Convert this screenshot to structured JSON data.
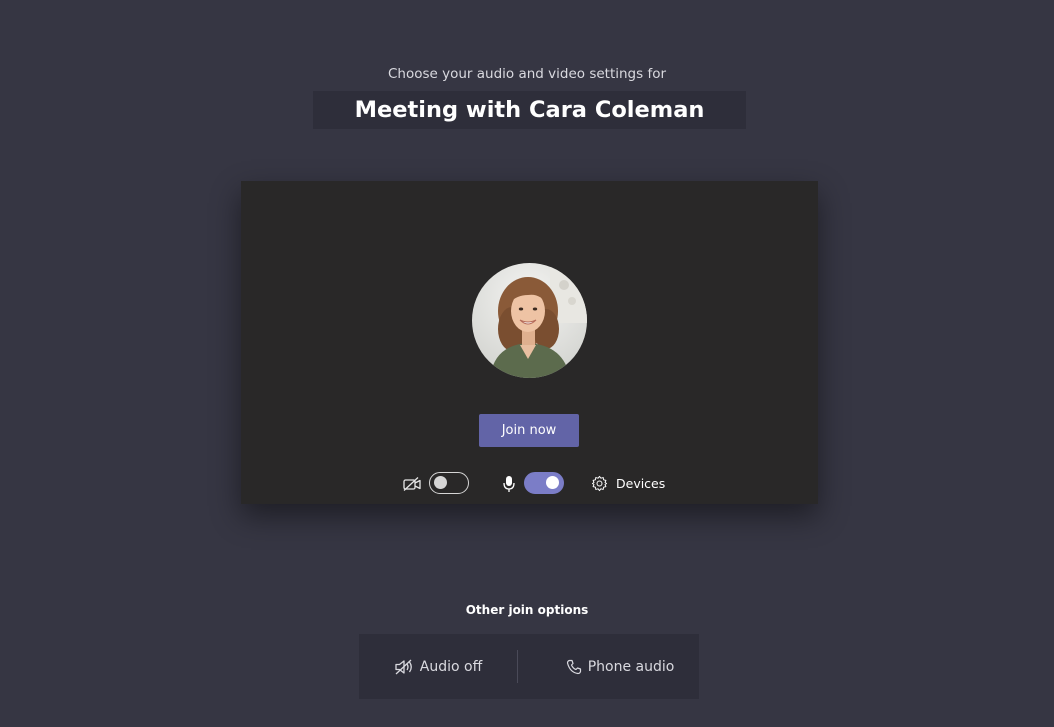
{
  "header": {
    "subtitle": "Choose your audio and video settings for",
    "meeting_title": "Meeting with Cara Coleman"
  },
  "preview": {
    "join_button_label": "Join now",
    "camera_toggle_on": false,
    "mic_toggle_on": true,
    "devices_label": "Devices"
  },
  "other_options": {
    "heading": "Other join options",
    "audio_off_label": "Audio off",
    "phone_audio_label": "Phone audio"
  },
  "colors": {
    "background": "#363643",
    "panel": "#2e2e3a",
    "preview": "#292828",
    "accent": "#6264a7",
    "toggle_on": "#7b7dc7"
  },
  "icons": [
    "video-off-icon",
    "microphone-icon",
    "gear-icon",
    "speaker-off-icon",
    "phone-icon"
  ]
}
